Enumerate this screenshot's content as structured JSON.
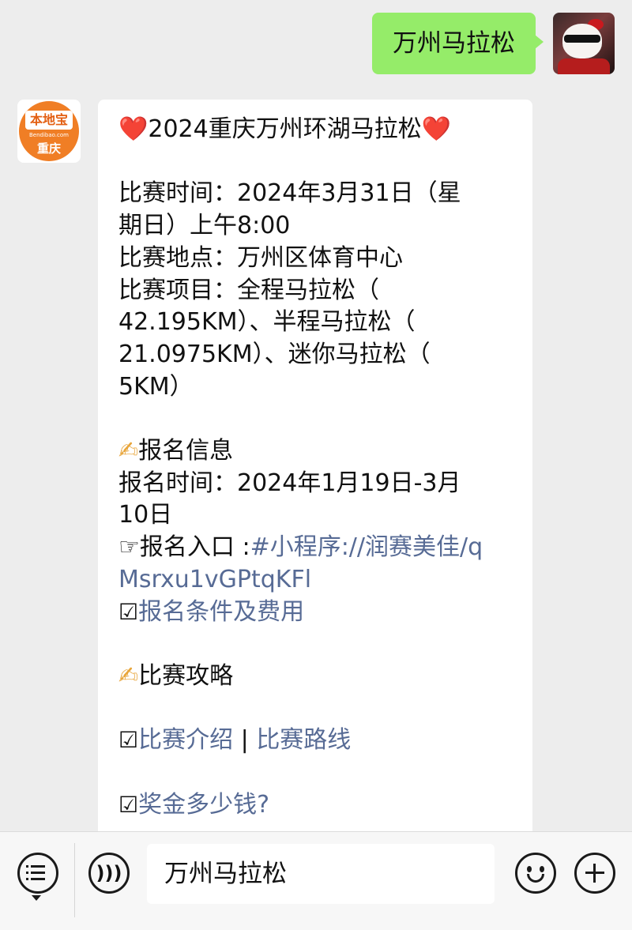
{
  "outgoing": {
    "text": "万州马拉松"
  },
  "incoming": {
    "avatar": {
      "logo_text": "本地宝",
      "logo_subtext": "Bendibao.com",
      "city": "重庆"
    },
    "title": "2024重庆万州环湖马拉松",
    "race_time_line1": "比赛时间：2024年3月31日（星",
    "race_time_line2": "期日）上午8:00",
    "race_location": "比赛地点：万州区体育中心",
    "race_events_line1": "比赛项目：全程马拉松（",
    "race_events_line2": "42.195KM）、半程马拉松（",
    "race_events_line3": "21.0975KM）、迷你马拉松（",
    "race_events_line4": "5KM）",
    "signup_heading": "报名信息",
    "signup_time_line1": "报名时间：2024年1月19日-3月",
    "signup_time_line2": "10日",
    "signup_entry_label": "报名入口 :",
    "signup_entry_link_line1": "#小程序://润赛美佳/q",
    "signup_entry_link_line2": "Msrxu1vGPtqKFl",
    "signup_conditions_link": "报名条件及费用",
    "guide_heading": "比赛攻略",
    "intro_link": "比赛介绍",
    "separator": "|",
    "route_link": "比赛路线",
    "prize_link": "奖金多少钱?"
  },
  "icons": {
    "heart": "❤️",
    "writing_hand": "✍",
    "pointing_hand": "☞",
    "check_box": "☑"
  },
  "input_bar": {
    "input_value": "万州马拉松"
  }
}
